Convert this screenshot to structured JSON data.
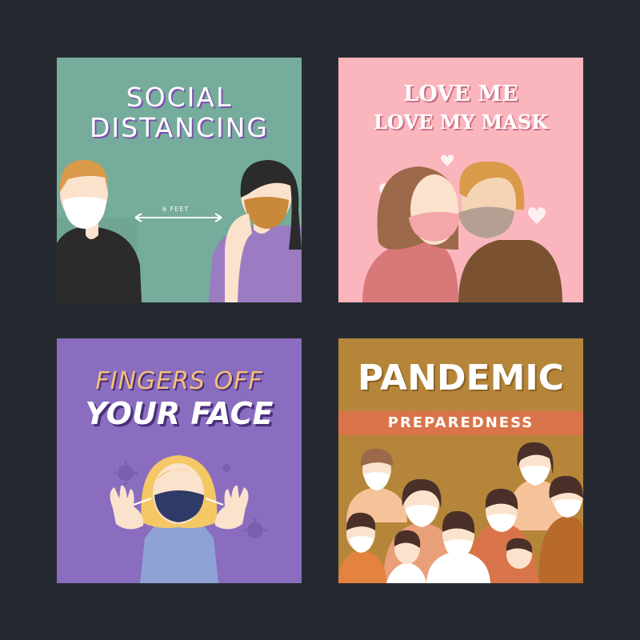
{
  "cards": [
    {
      "title_line1": "SOCIAL",
      "title_line2": "DISTANCING",
      "distance_label": "6 FEET",
      "background": "#76ac9c"
    },
    {
      "title_line1": "LOVE ME",
      "title_line2": "LOVE MY MASK",
      "background": "#fbb5bd"
    },
    {
      "title_line1": "FINGERS OFF",
      "title_line2": "YOUR FACE",
      "background": "#8a6dbf"
    },
    {
      "title_line1": "PANDEMIC",
      "title_line2": "PREPAREDNESS",
      "background": "#b5863a"
    }
  ],
  "page_background": "#252a31"
}
